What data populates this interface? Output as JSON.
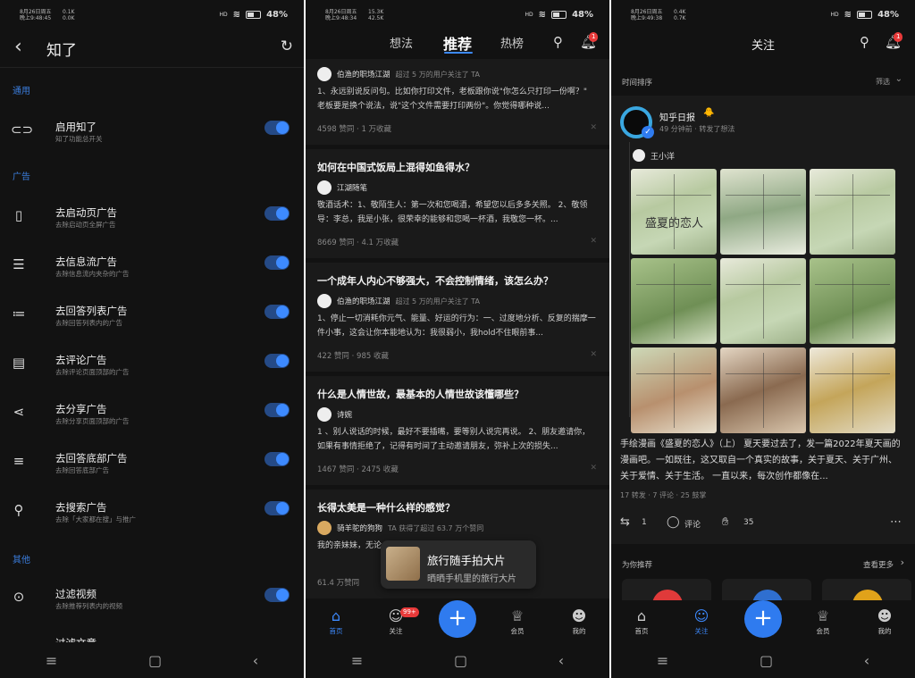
{
  "status": {
    "p1": {
      "date": "8月26日周五",
      "time": "晚上9:48:45",
      "up": "0.1K",
      "down": "0.0K"
    },
    "p2": {
      "date": "8月26日周五",
      "time": "晚上9:48:34",
      "up": "15.3K",
      "down": "42.5K"
    },
    "p3": {
      "date": "8月26日周五",
      "time": "晚上9:49:38",
      "up": "0.4K",
      "down": "0.7K"
    },
    "battery": "48%",
    "signal": "HD"
  },
  "p1": {
    "title": "知了",
    "sections": [
      "通用",
      "广告",
      "其他"
    ],
    "rows": [
      {
        "title": "启用知了",
        "sub": "知了功能总开关",
        "icon": "toggle-icon"
      },
      {
        "title": "去启动页广告",
        "sub": "去除启动页全屏广告",
        "icon": "phone-icon"
      },
      {
        "title": "去信息流广告",
        "sub": "去除信息流内夹杂的广告",
        "icon": "feed-icon"
      },
      {
        "title": "去回答列表广告",
        "sub": "去除回答列表内的广告",
        "icon": "list-icon"
      },
      {
        "title": "去评论广告",
        "sub": "去除评论页面顶部的广告",
        "icon": "comment-icon"
      },
      {
        "title": "去分享广告",
        "sub": "去除分享页面顶部的广告",
        "icon": "share-icon"
      },
      {
        "title": "去回答底部广告",
        "sub": "去除回答底部广告",
        "icon": "text-icon"
      },
      {
        "title": "去搜索广告",
        "sub": "去除「大家都在搜」与推广",
        "icon": "search-icon"
      },
      {
        "title": "过滤视频",
        "sub": "去除推荐列表内的视频",
        "icon": "play-icon"
      },
      {
        "title": "过滤文章",
        "sub": "",
        "icon": "article-icon"
      }
    ]
  },
  "p2": {
    "tabs": [
      "想法",
      "推荐",
      "热榜"
    ],
    "notif_badge": "1",
    "cards": [
      {
        "title": "",
        "author": "伯渔的职场江湖",
        "author_note": "超过 5 万的用户关注了 TA",
        "text": "1、永远别说反问句。比如你打印文件，老板跟你说\"你怎么只打印一份啊？\" 老板要是换个说法，说\"这个文件需要打印两份\"。你觉得哪种说...",
        "meta": "4598 赞同 · 1 万收藏"
      },
      {
        "title": "如何在中国式饭局上混得如鱼得水？",
        "author": "江湖随笔",
        "author_note": "",
        "text": "敬酒话术：1、敬陌生人：第一次和您喝酒，希望您以后多多关照。 2、敬领导：李总，我是小张，很荣幸的能够和您喝一杯酒，我敬您一杯。...",
        "meta": "8669 赞同 · 4.1 万收藏"
      },
      {
        "title": "一个成年人内心不够强大，不会控制情绪，该怎么办？",
        "author": "伯渔的职场江湖",
        "author_note": "超过 5 万的用户关注了 TA",
        "text": "1、停止一切消耗你元气、能量、好运的行为：一、过度地分析、反复的揣摩一件小事，这会让你本能地认为：我很弱小，我hold不住眼前事...",
        "meta": "422 赞同 · 985 收藏"
      },
      {
        "title": "什么是人情世故，最基本的人情世故该懂哪些？",
        "author": "诗婉",
        "author_note": "",
        "text": "1 、别人说话的时候，最好不要插嘴，要等别人说完再说。 2、朋友邀请你，如果有事情拒绝了，记得有时间了主动邀请朋友，弥补上次的损失...",
        "meta": "1467 赞同 · 2475 收藏"
      },
      {
        "title": "长得太美是一种什么样的感觉？",
        "author": "骑羊驼的狗狗",
        "author_note": "TA 获得了超过 63.7 万个赞同",
        "text": "我的亲妹妹，无论... 会被人要微信！！！ 去海南... 这是在...",
        "meta": "61.4 万赞同"
      }
    ],
    "toast": {
      "title": "旅行随手拍大片",
      "sub": "晒晒手机里的旅行大片"
    },
    "bottom_tabs": [
      "首页",
      "关注",
      "会员",
      "我的"
    ],
    "follow_badge": "99+"
  },
  "p3": {
    "title": "关注",
    "notif_badge": "1",
    "sort_label": "时间排序",
    "filter_label": "筛选",
    "publisher": "知乎日报",
    "pub_time": "49 分钟前 · 转发了想法",
    "reposter": "王小洋",
    "manga_title": "盛夏的恋人",
    "desc": "手绘漫画《盛夏的恋人》（上） 夏天要过去了，发一篇2022年夏天画的漫画吧。一如既往，这又取自一个真实的故事，关于夏天、关于广州、关于爱情、关于生活。 一直以来，每次创作都像在...",
    "stats": "17 转发 · 7 评论 · 25 鼓掌",
    "repost_count": "1",
    "comment_label": "评论",
    "clap_count": "35",
    "rec_label": "为你推荐",
    "rec_more": "查看更多",
    "bottom_tabs": [
      "首页",
      "关注",
      "会员",
      "我的"
    ]
  }
}
